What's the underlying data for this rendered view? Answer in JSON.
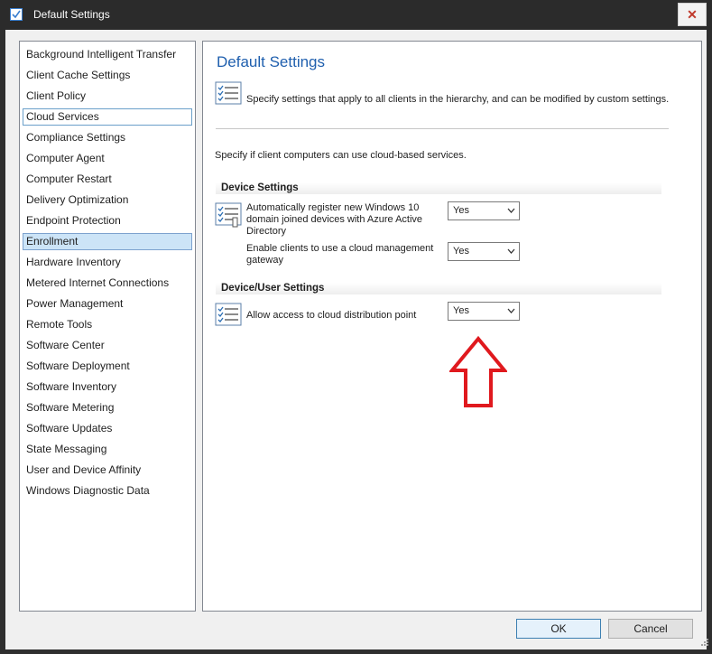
{
  "window": {
    "title": "Default Settings",
    "close_symbol": "✕"
  },
  "sidebar": {
    "items": [
      {
        "label": "Background Intelligent Transfer",
        "state": "normal"
      },
      {
        "label": "Client Cache Settings",
        "state": "normal"
      },
      {
        "label": "Client Policy",
        "state": "normal"
      },
      {
        "label": "Cloud Services",
        "state": "focused"
      },
      {
        "label": "Compliance Settings",
        "state": "normal"
      },
      {
        "label": "Computer Agent",
        "state": "normal"
      },
      {
        "label": "Computer Restart",
        "state": "normal"
      },
      {
        "label": "Delivery Optimization",
        "state": "normal"
      },
      {
        "label": "Endpoint Protection",
        "state": "normal"
      },
      {
        "label": "Enrollment",
        "state": "selected"
      },
      {
        "label": "Hardware Inventory",
        "state": "normal"
      },
      {
        "label": "Metered Internet Connections",
        "state": "normal"
      },
      {
        "label": "Power Management",
        "state": "normal"
      },
      {
        "label": "Remote Tools",
        "state": "normal"
      },
      {
        "label": "Software Center",
        "state": "normal"
      },
      {
        "label": "Software Deployment",
        "state": "normal"
      },
      {
        "label": "Software Inventory",
        "state": "normal"
      },
      {
        "label": "Software Metering",
        "state": "normal"
      },
      {
        "label": "Software Updates",
        "state": "normal"
      },
      {
        "label": "State Messaging",
        "state": "normal"
      },
      {
        "label": "User and Device Affinity",
        "state": "normal"
      },
      {
        "label": "Windows Diagnostic Data",
        "state": "normal"
      }
    ]
  },
  "main": {
    "title": "Default Settings",
    "description": "Specify settings that apply to all clients in the hierarchy, and can be modified by custom settings.",
    "intro": "Specify if client computers can use cloud-based services.",
    "groups": [
      {
        "header": "Device Settings",
        "settings": [
          {
            "label": "Automatically register new Windows 10 domain joined devices with Azure Active Directory",
            "value": "Yes",
            "icon": "settings-list-icon"
          },
          {
            "label": "Enable clients to use a cloud management gateway",
            "value": "Yes"
          }
        ]
      },
      {
        "header": "Device/User Settings",
        "settings": [
          {
            "label": "Allow access to cloud distribution point",
            "value": "Yes",
            "icon": "settings-list-icon"
          }
        ]
      }
    ]
  },
  "annotation": {
    "type": "arrow",
    "direction": "up",
    "color": "#e0191e"
  },
  "buttons": {
    "ok": "OK",
    "cancel": "Cancel"
  },
  "colors": {
    "title_blue": "#1f5fae",
    "selection": "#cce4f7",
    "accent_red": "#e0191e"
  }
}
